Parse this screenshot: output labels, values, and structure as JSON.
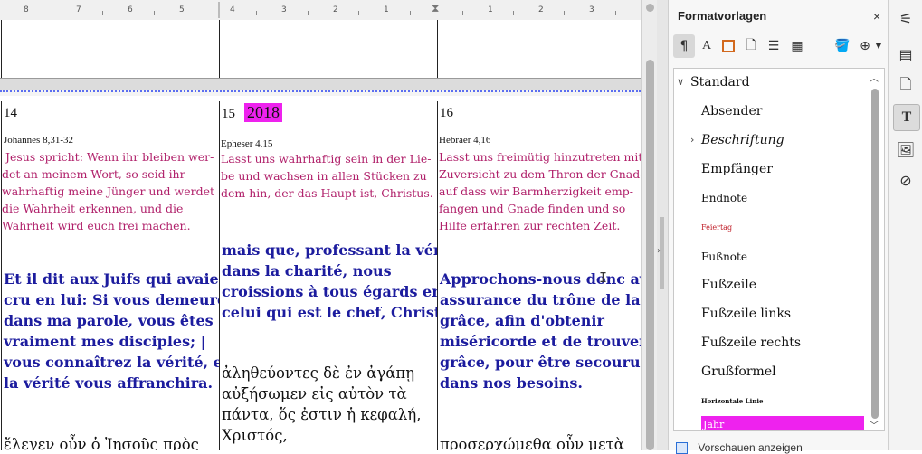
{
  "ruler": {
    "left_ticks": [
      "8",
      "7",
      "6",
      "5"
    ],
    "right_ticks": [
      "4",
      "3",
      "2",
      "1",
      "1",
      "2",
      "3"
    ]
  },
  "document": {
    "cells": [
      {
        "day": "14",
        "ref": "Johannes 8,31-32",
        "german": " Jesus spricht: Wenn ihr bleiben wer-\ndet an meinem Wort, so seid ihr\nwahrhaftig meine Jünger und werdet\ndie Wahrheit erkennen, und die\nWahrheit wird euch frei machen.",
        "french": "Et il dit aux Juifs qui avaient\ncru en lui: Si vous demeurez\ndans ma parole, vous êtes\nvraiment mes disciples; |\nvous connaîtrez la vérité, et\nla vérité vous affranchira.",
        "greek": "ἔλεγεν οὖν ὁ Ἰησοῦς πρὸς"
      },
      {
        "day": "15",
        "year": "2018",
        "ref": "Epheser 4,15",
        "german": "Lasst uns wahrhaftig sein in der Lie-\nbe und wachsen in allen Stücken zu\ndem hin, der das Haupt ist, Christus.",
        "french": "mais que, professant la vérité\ndans la charité, nous\ncroissions à tous égards en\ncelui qui est le chef, Christ.",
        "greek": "ἀληθεύοντες δὲ ἐν ἀγάπῃ\nαὐξήσωμεν εἰς αὐτὸν τὰ\nπάντα, ὅς ἐστιν ἡ κεφαλή,\nΧριστός,"
      },
      {
        "day": "16",
        "ref": "Hebräer 4,16",
        "german": "Lasst uns freimütig hinzutreten mit\nZuversicht zu dem Thron der Gnade,\nauf dass wir Barmherzigkeit emp-\nfangen und Gnade finden und so\nHilfe erfahren zur rechten Zeit.",
        "french": "Approchons-nous donc avec\nassurance du trône de la\ngrâce, afin d'obtenir\nmiséricorde et de trouver\ngrâce, pour être secourus\ndans nos besoins.",
        "greek": "προσερχώμεθα οὖν μετὰ"
      }
    ]
  },
  "panel": {
    "title": "Formatvorlagen",
    "close_icon": "close-icon",
    "styles": [
      {
        "label": "Standard"
      },
      {
        "label": "Absender"
      },
      {
        "label": "Beschriftung"
      },
      {
        "label": "Empfänger"
      },
      {
        "label": "Endnote"
      },
      {
        "label": "Feiertag"
      },
      {
        "label": "Fußnote"
      },
      {
        "label": "Fußzeile"
      },
      {
        "label": "Fußzeile links"
      },
      {
        "label": "Fußzeile rechts"
      },
      {
        "label": "Grußformel"
      },
      {
        "label": "Horizontale Linie"
      },
      {
        "label": "Jahr"
      }
    ],
    "bottom_option": "Vorschauen anzeigen"
  },
  "colors": {
    "german_text": "#b0206a",
    "french_text": "#1c1c9e",
    "year_highlight": "#ee22ee",
    "feiertag": "#c0202a"
  }
}
